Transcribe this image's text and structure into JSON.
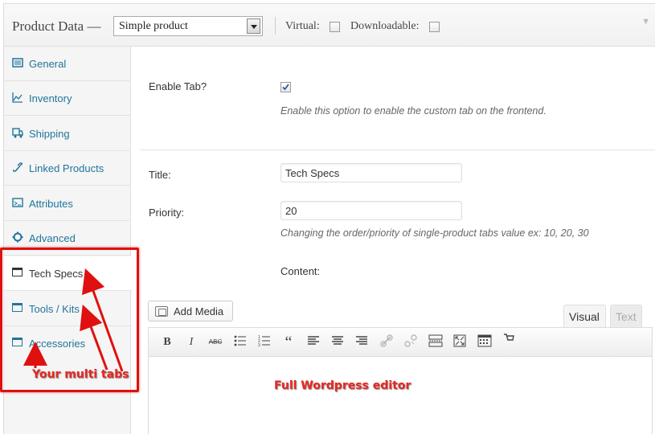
{
  "header": {
    "title": "Product Data —",
    "product_type": "Simple product",
    "virtual_label": "Virtual:",
    "downloadable_label": "Downloadable:"
  },
  "sidebar": {
    "items": [
      {
        "label": "General",
        "icon": "general-icon"
      },
      {
        "label": "Inventory",
        "icon": "inventory-icon"
      },
      {
        "label": "Shipping",
        "icon": "shipping-icon"
      },
      {
        "label": "Linked Products",
        "icon": "link-icon"
      },
      {
        "label": "Attributes",
        "icon": "attributes-icon"
      },
      {
        "label": "Advanced",
        "icon": "gear-icon"
      },
      {
        "label": "Tech Specs",
        "icon": "window-icon",
        "active": true
      },
      {
        "label": "Tools / Kits",
        "icon": "window-icon"
      },
      {
        "label": "Accessories",
        "icon": "window-icon"
      }
    ]
  },
  "form": {
    "enable_tab_label": "Enable Tab?",
    "enable_tab_checked": true,
    "enable_tab_desc": "Enable this option to enable the custom tab on the frontend.",
    "title_label": "Title:",
    "title_value": "Tech Specs",
    "priority_label": "Priority:",
    "priority_value": "20",
    "priority_desc": "Changing the order/priority of single-product tabs value ex: 10, 20, 30",
    "content_label": "Content:"
  },
  "editor": {
    "add_media_label": "Add Media",
    "visual_tab": "Visual",
    "text_tab": "Text",
    "toolbar": [
      "bold-icon",
      "italic-icon",
      "strikethrough-icon",
      "bullet-list-icon",
      "numbered-list-icon",
      "blockquote-icon",
      "align-left-icon",
      "align-center-icon",
      "align-right-icon",
      "link-icon",
      "unlink-icon",
      "read-more-icon",
      "fullscreen-icon",
      "toolbar-toggle-icon",
      "woocommerce-icon"
    ]
  },
  "annotations": {
    "multi_tabs": "Your multi tabs",
    "full_editor": "Full Wordpress editor",
    "color": "#e8261f"
  }
}
